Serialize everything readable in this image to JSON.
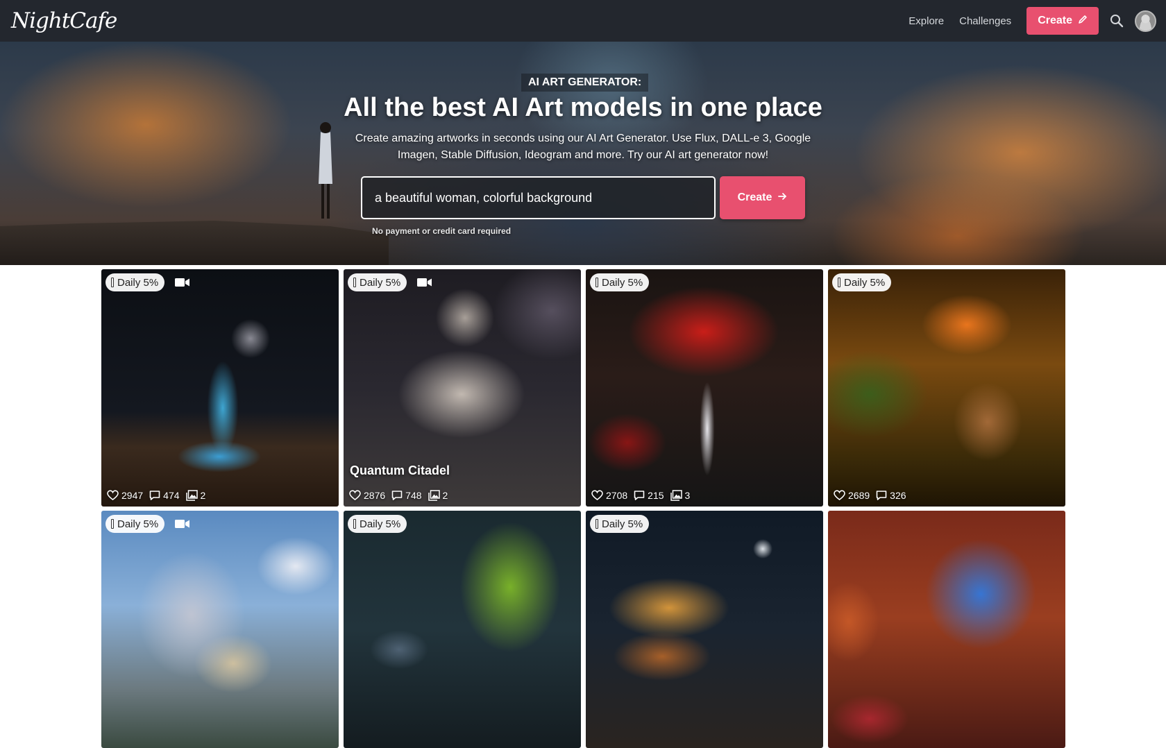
{
  "navbar": {
    "logo_text": "NightCafe",
    "explore": "Explore",
    "challenges": "Challenges",
    "create": "Create",
    "icons": [
      "pencil-icon",
      "search-icon",
      "avatar"
    ]
  },
  "hero": {
    "eyebrow": "AI ART GENERATOR:",
    "title": "All the best AI Art models in one place",
    "subtitle": "Create amazing artworks in seconds using our AI Art Generator. Use Flux, DALL-e 3, Google Imagen, Stable Diffusion, Ideogram and more. Try our AI art generator now!",
    "prompt_value": "a beautiful woman, colorful background",
    "create": "Create",
    "note": "No payment or credit card required"
  },
  "colors": {
    "accent": "#e8506f",
    "navbar": "#23272e"
  },
  "cards": [
    {
      "badge": "Daily 5%",
      "video": true,
      "title": "",
      "likes": "2947",
      "comments": "474",
      "images": "2"
    },
    {
      "badge": "Daily 5%",
      "video": true,
      "title": "Quantum Citadel",
      "likes": "2876",
      "comments": "748",
      "images": "2"
    },
    {
      "badge": "Daily 5%",
      "video": false,
      "title": "",
      "likes": "2708",
      "comments": "215",
      "images": "3"
    },
    {
      "badge": "Daily 5%",
      "video": false,
      "title": "",
      "likes": "2689",
      "comments": "326",
      "images": ""
    },
    {
      "badge": "Daily 5%",
      "video": true,
      "title": "",
      "likes": "",
      "comments": "",
      "images": ""
    },
    {
      "badge": "Daily 5%",
      "video": false,
      "title": "",
      "likes": "",
      "comments": "",
      "images": ""
    },
    {
      "badge": "Daily 5%",
      "video": false,
      "title": "",
      "likes": "",
      "comments": "",
      "images": ""
    },
    {
      "badge": "",
      "video": false,
      "title": "",
      "likes": "",
      "comments": "",
      "images": ""
    }
  ]
}
